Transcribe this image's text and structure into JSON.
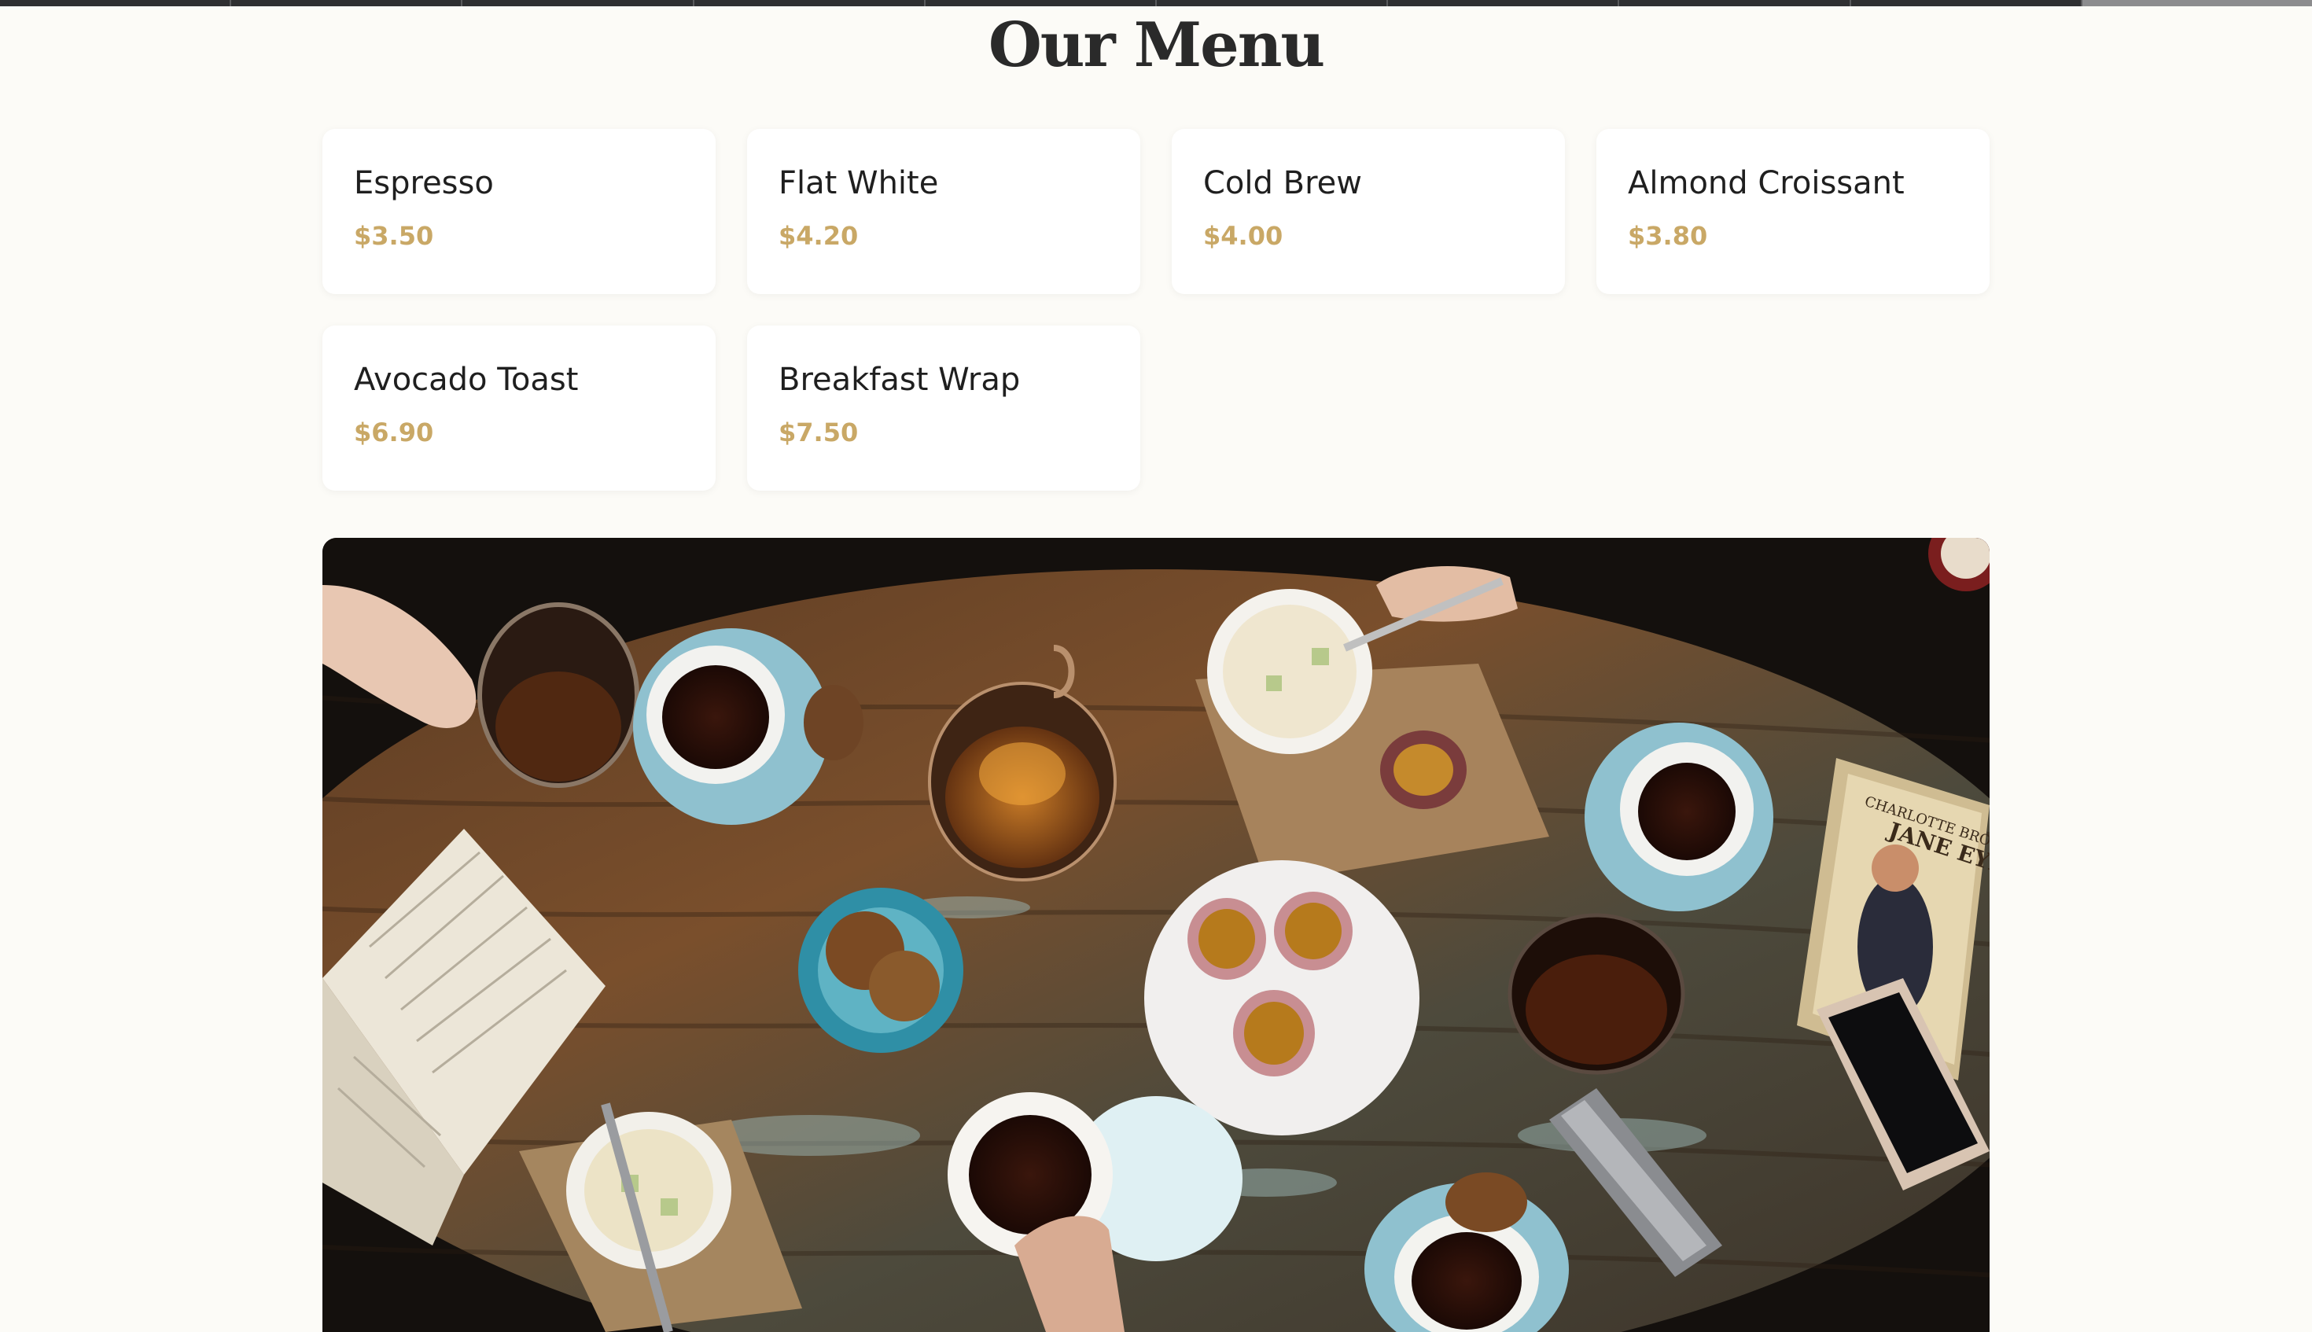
{
  "page": {
    "title": "Our Menu"
  },
  "menu": {
    "items": [
      {
        "name": "Espresso",
        "price": "$3.50"
      },
      {
        "name": "Flat White",
        "price": "$4.20"
      },
      {
        "name": "Cold Brew",
        "price": "$4.00"
      },
      {
        "name": "Almond Croissant",
        "price": "$3.80"
      },
      {
        "name": "Avocado Toast",
        "price": "$6.90"
      },
      {
        "name": "Breakfast Wrap",
        "price": "$7.50"
      }
    ]
  },
  "photo": {
    "book_title": "JANE EYRE",
    "book_author": "CHARLOTTE BRONTË"
  },
  "colors": {
    "background": "#fcfbf7",
    "card": "#ffffff",
    "price_accent": "#c9a866",
    "heading": "#2a2a2a"
  }
}
